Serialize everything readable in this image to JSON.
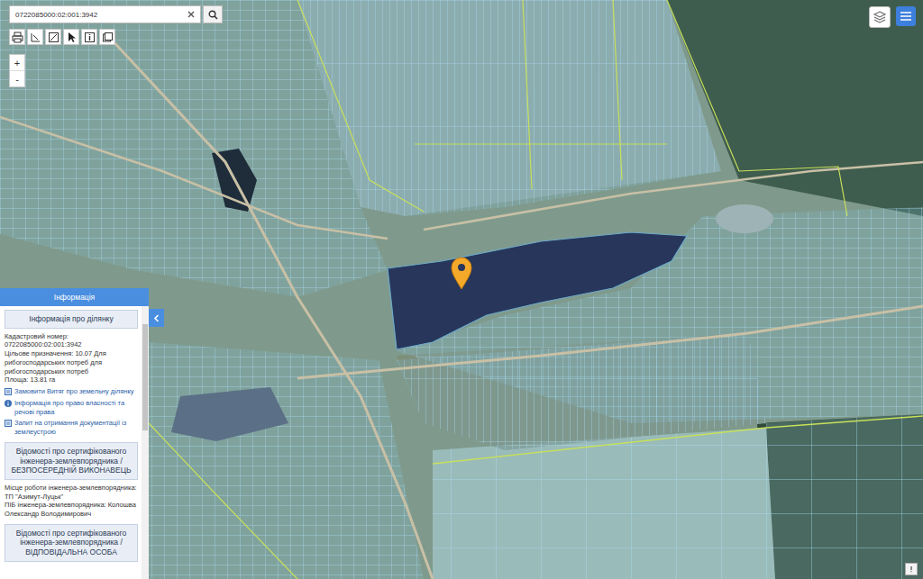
{
  "search": {
    "value": "0722085000:02:001:3942"
  },
  "zoom": [
    "+",
    "-"
  ],
  "panel": {
    "title": "Інформація",
    "sections": [
      {
        "title": "Інформація про ділянку",
        "lines": [
          "Кадастровий номер:",
          "0722085000:02:001:3942",
          "Цільове призначення: 10.07 Для рибогосподарських потреб для рибогосподарських потреб",
          "Площа: 13.81 га"
        ],
        "links": [
          {
            "text": "Замовити Витяг про земельну ділянку",
            "kind": "document"
          },
          {
            "text": "Інформація про право власності та речові права",
            "kind": "info"
          },
          {
            "text": "Запит на отримання документації із землеустрою",
            "kind": "document"
          }
        ]
      },
      {
        "title": "Відомості про сертифікованого інженера-землевпорядника / БЕЗПОСЕРЕДНІЙ ВИКОНАВЕЦЬ",
        "lines": [
          "Місце роботи інженера-землевпорядника: ТП \"Азимут-Луцьк\"",
          "ПІБ інженера-землевпорядника: Колошва Олександр Володимирович"
        ],
        "links": []
      },
      {
        "title": "Відомості про сертифікованого інженера-землевпорядника / ВІДПОВІДАЛЬНА ОСОБА",
        "lines": [],
        "links": []
      }
    ]
  }
}
